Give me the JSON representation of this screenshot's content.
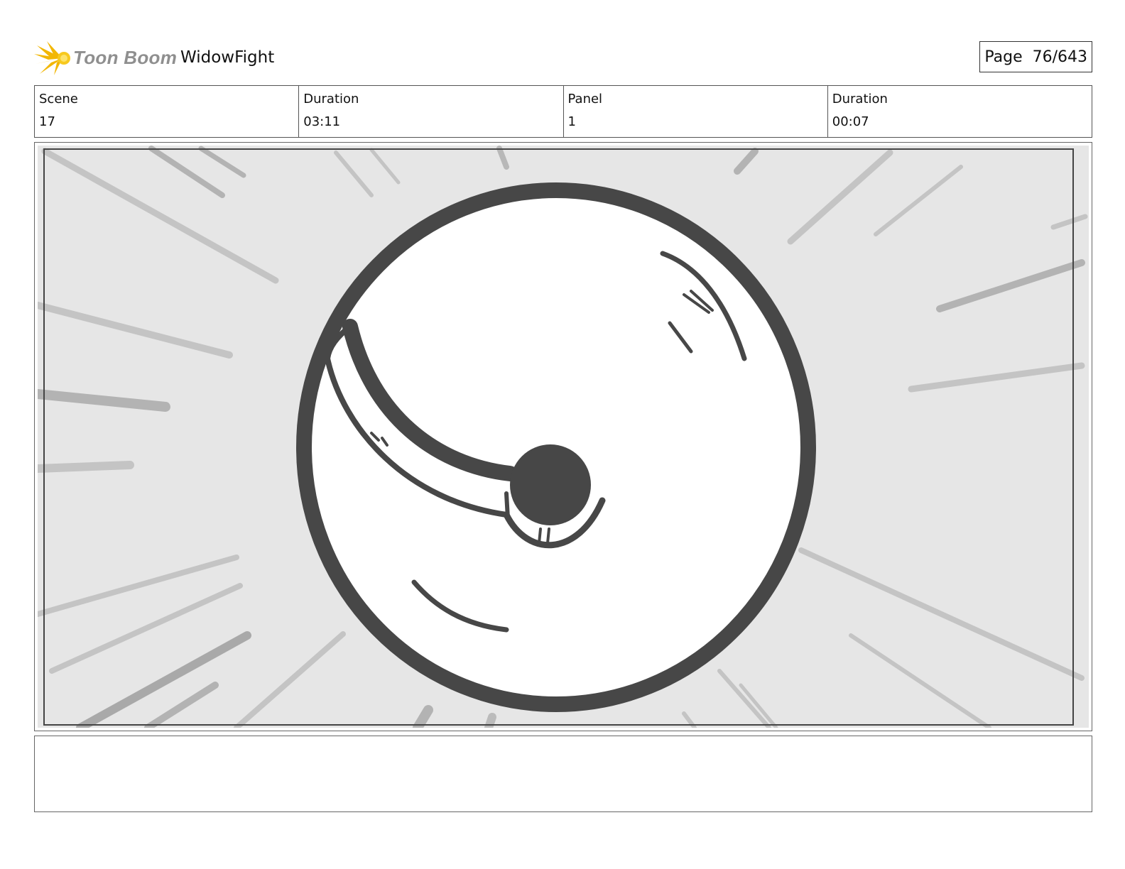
{
  "header": {
    "logo_text": "Toon Boom",
    "project_title": "WidowFight",
    "page_label": "Page  76/643"
  },
  "info": {
    "scene_label": "Scene",
    "scene_value": "17",
    "scene_duration_label": "Duration",
    "scene_duration_value": "03:11",
    "panel_label": "Panel",
    "panel_value": "1",
    "panel_duration_label": "Duration",
    "panel_duration_value": "00:07"
  },
  "panel": {
    "image_description_icon": "storyboard-sketch-ball-icon"
  },
  "notes": {
    "text": ""
  },
  "colors": {
    "logo_star": "#f2b705",
    "logo_text": "#8f8f8f",
    "sketch_ink": "#474747",
    "speed_lines": "#bdbdbd",
    "panel_bg": "#e6e6e6"
  }
}
